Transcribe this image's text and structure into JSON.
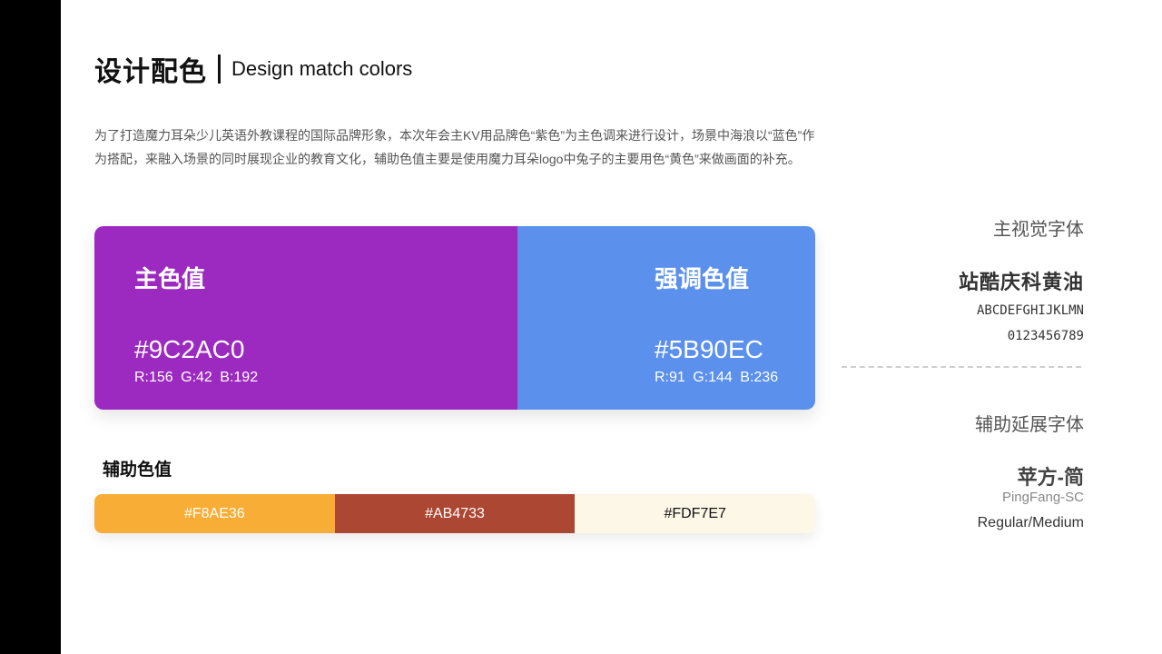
{
  "header": {
    "title_cn": "设计配色",
    "title_en": "Design match colors"
  },
  "intro": {
    "text": "为了打造魔力耳朵少儿英语外教课程的国际品牌形象，本次年会主KV用品牌色“紫色”为主色调来进行设计，场景中海浪以“蓝色”作为搭配，来融入场景的同时展现企业的教育文化，辅助色值主要是使用魔力耳朵logo中兔子的主要用色“黄色”来做画面的补充。"
  },
  "main_colors": {
    "primary": {
      "label": "主色值",
      "hex": "#9C2AC0",
      "rgb": "R:156   G:42   B:192",
      "color": "#9C2AC0"
    },
    "accent": {
      "label": "强调色值",
      "hex": "#5B90EC",
      "rgb": "R:91   G:144   B:236",
      "color": "#5B90EC"
    }
  },
  "aux_colors": {
    "title": "辅助色值",
    "swatches": [
      {
        "hex": "#F8AE36",
        "color": "#F8AE36",
        "text_color": "#ffffff"
      },
      {
        "hex": "#AB4733",
        "color": "#AB4733",
        "text_color": "#ffffff"
      },
      {
        "hex": "#FDF7E7",
        "color": "#FDF7E7",
        "text_color": "#111111"
      }
    ]
  },
  "fonts": {
    "main_heading": "主视觉字体",
    "main_font": "站酷庆科黄油",
    "main_sample_letters": "ABCDEFGHIJKLMN",
    "main_sample_digits": "0123456789",
    "aux_heading": "辅助延展字体",
    "aux_font": "苹方-简",
    "aux_font_en": "PingFang-SC",
    "aux_weights": "Regular/Medium"
  }
}
